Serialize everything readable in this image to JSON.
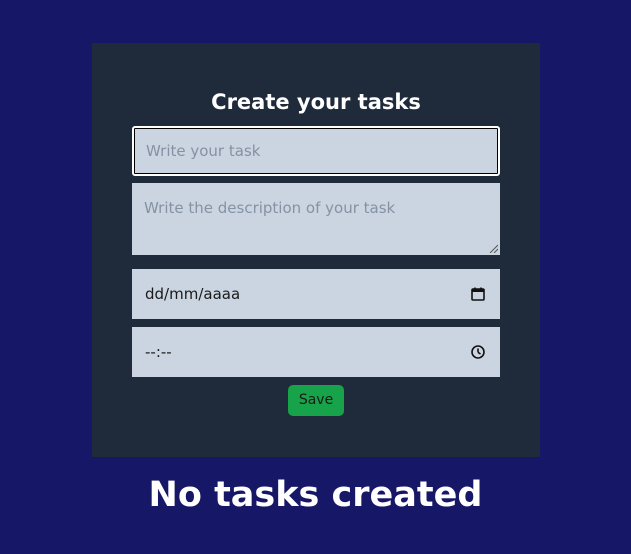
{
  "form": {
    "title": "Create your tasks",
    "task_placeholder": "Write your task",
    "description_placeholder": "Write the description of your task",
    "date_placeholder": "dd/mm/aaaa",
    "time_placeholder": "--:--",
    "date_icon": "calendar-icon",
    "time_icon": "clock-icon",
    "save_label": "Save"
  },
  "tasks": {
    "empty_message": "No tasks created"
  },
  "colors": {
    "page_background": "#171767",
    "card_background": "#1f2a3b",
    "input_background": "#cbd5e1",
    "save_button": "#16a34a"
  }
}
